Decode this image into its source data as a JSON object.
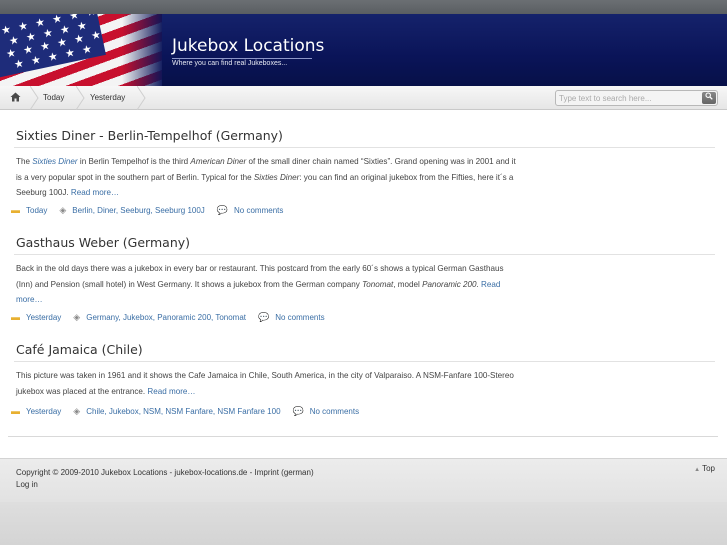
{
  "site": {
    "title": "Jukebox Locations",
    "tagline": "Where you can find real Jukeboxes..."
  },
  "nav": {
    "home_icon": "home-icon",
    "tabs": [
      {
        "label": "Today"
      },
      {
        "label": "Yesterday"
      }
    ],
    "search_placeholder": "Type text to search here...",
    "search_icon": "search-icon"
  },
  "posts": [
    {
      "title": "Sixties Diner - Berlin-Tempelhof (Germany)",
      "body": [
        {
          "t": "The "
        },
        {
          "t": "Sixties Diner",
          "link": true,
          "em": true
        },
        {
          "t": " in Berlin Tempelhof is the third  "
        },
        {
          "t": "American Diner",
          "em": true
        },
        {
          "t": " of the  small diner chain named “Sixties”. Grand opening was in 2001 and it is a very popular spot in the southern part of  Berlin. Typical for the "
        },
        {
          "t": "Sixties Diner",
          "em": true
        },
        {
          "t": ": you can find an original jukebox from the Fifties, here it´s a Seeburg 100J. "
        },
        {
          "t": "Read more…",
          "link": true
        }
      ],
      "category": "Today",
      "tags": "Berlin, Diner, Seeburg, Seeburg 100J",
      "comments": "No comments"
    },
    {
      "title": "Gasthaus Weber (Germany)",
      "body": [
        {
          "t": "Back in the old days there was a jukebox in every bar or restaurant. This postcard from the early 60´s shows a typical German Gasthaus (Inn) and Pension (small hotel) in West Germany. It shows a jukebox from the German company "
        },
        {
          "t": "Tonomat",
          "em": true
        },
        {
          "t": ", model "
        },
        {
          "t": "Panoramic 200",
          "em": true
        },
        {
          "t": ". "
        },
        {
          "t": "Read more…",
          "link": true
        }
      ],
      "category": "Yesterday",
      "tags": "Germany, Jukebox, Panoramic 200, Tonomat",
      "comments": "No comments"
    },
    {
      "title": "Café Jamaica (Chile)",
      "body": [
        {
          "t": "This picture was taken in 1961 and it shows the Cafe Jamaica in Chile, South America, in the city of Valparaiso. A NSM-Fanfare 100-Stereo jukebox was placed at the entrance. "
        },
        {
          "t": "Read more…",
          "link": true
        }
      ],
      "category": "Yesterday",
      "tags": "Chile, Jukebox, NSM, NSM Fanfare, NSM Fanfare 100",
      "comments": "No comments"
    }
  ],
  "meta_icons": {
    "category": "folder-icon",
    "tags": "tag-icon",
    "comments": "comment-icon"
  },
  "footer": {
    "copyright": "Copyright © 2009-2010 Jukebox Locations - jukebox-locations.de - Imprint (german)",
    "login": "Log in",
    "top": "Top"
  },
  "colors": {
    "header_bg": "#0a1458",
    "link": "#3a6ea5",
    "flag_red": "#c8102e"
  }
}
